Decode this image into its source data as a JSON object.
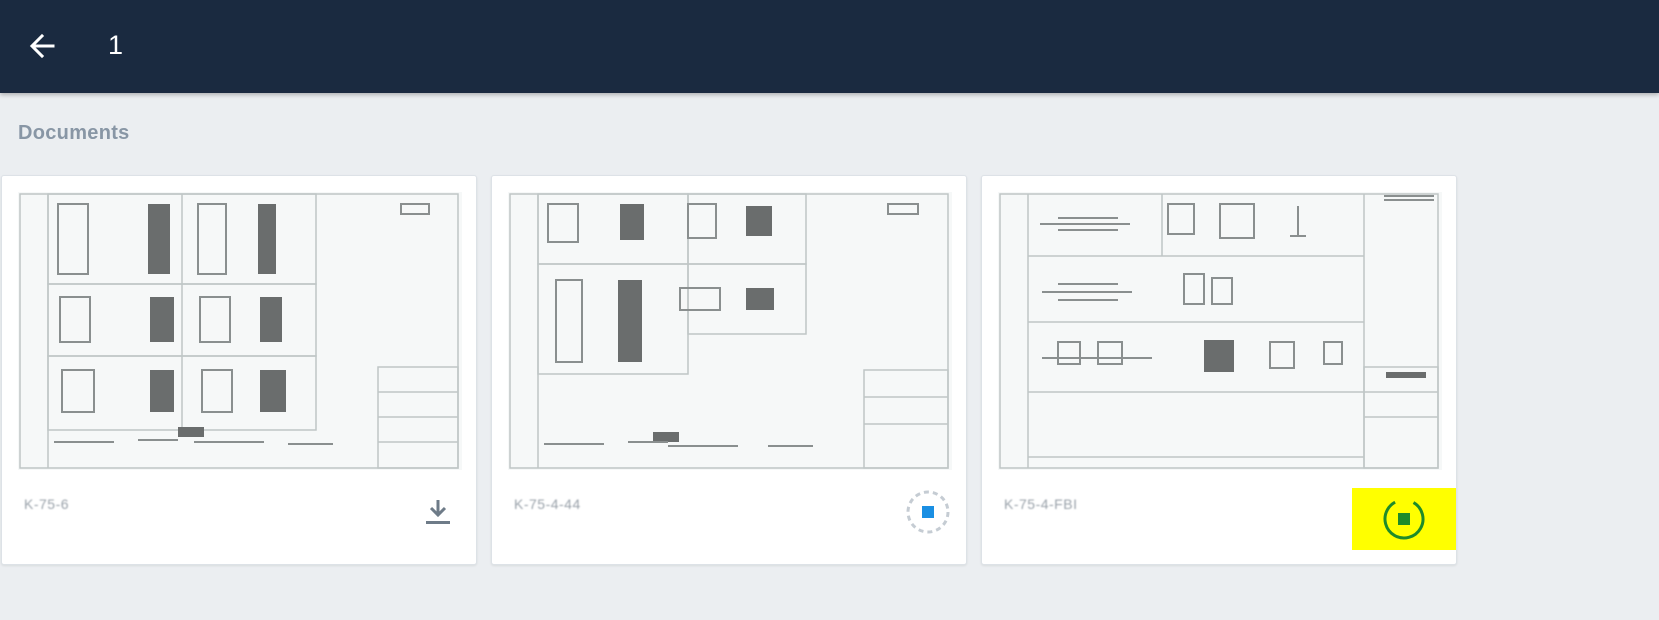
{
  "header": {
    "back_icon": "arrow-left-icon",
    "title": "1"
  },
  "section": {
    "label": "Documents"
  },
  "documents": [
    {
      "name": "K-75-6",
      "action_icon": "download-icon"
    },
    {
      "name": "K-75-4-44",
      "action_icon": "sync-pending-icon"
    },
    {
      "name": "K-75-4-FBI",
      "action_icon": "sync-active-icon",
      "highlight_color": "#ffff00"
    }
  ],
  "colors": {
    "header_bg": "#1a2a40",
    "page_bg": "#ebeef1",
    "pending_blue": "#1a8fe3",
    "active_green": "#1e8b2a"
  }
}
